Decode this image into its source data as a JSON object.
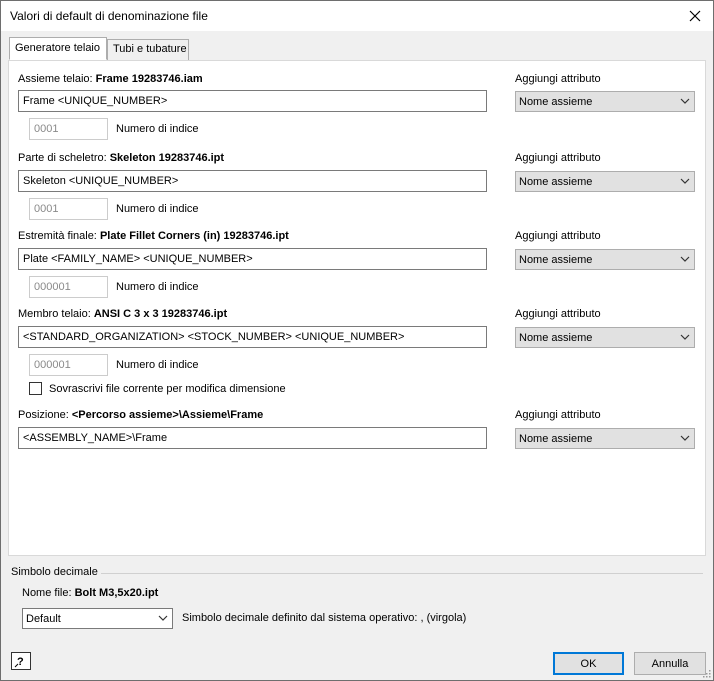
{
  "window": {
    "title": "Valori di default di denominazione file"
  },
  "tabs": [
    {
      "label": "Generatore telaio",
      "active": true
    },
    {
      "label": "Tubi e tubature",
      "active": false
    }
  ],
  "sections": [
    {
      "label": "Assieme telaio:",
      "value": "Frame 19283746.iam",
      "pattern": "Frame <UNIQUE_NUMBER>",
      "attr_label": "Aggiungi attributo",
      "attr_value": "Nome assieme",
      "index": "0001",
      "index_label": "Numero di indice"
    },
    {
      "label": "Parte di scheletro:",
      "value": "Skeleton 19283746.ipt",
      "pattern": "Skeleton <UNIQUE_NUMBER>",
      "attr_label": "Aggiungi attributo",
      "attr_value": "Nome assieme",
      "index": "0001",
      "index_label": "Numero di indice"
    },
    {
      "label": "Estremità finale:",
      "value": "Plate Fillet Corners (in) 19283746.ipt",
      "pattern": "Plate <FAMILY_NAME> <UNIQUE_NUMBER>",
      "attr_label": "Aggiungi attributo",
      "attr_value": "Nome assieme",
      "index": "000001",
      "index_label": "Numero di indice"
    },
    {
      "label": "Membro telaio:",
      "value": "ANSI C 3 x 3 19283746.ipt",
      "pattern": "<STANDARD_ORGANIZATION> <STOCK_NUMBER> <UNIQUE_NUMBER>",
      "attr_label": "Aggiungi attributo",
      "attr_value": "Nome assieme",
      "index": "000001",
      "index_label": "Numero di indice"
    }
  ],
  "overwrite_checkbox": {
    "label": "Sovrascrivi file corrente per modifica dimensione",
    "checked": false
  },
  "position": {
    "label": "Posizione:",
    "value": "<Percorso assieme>\\Assieme\\Frame",
    "pattern": "<ASSEMBLY_NAME>\\Frame",
    "attr_label": "Aggiungi attributo",
    "attr_value": "Nome assieme"
  },
  "decimal": {
    "group_label": "Simbolo decimale",
    "filename_label": "Nome file:",
    "filename_value": "Bolt M3,5x20.ipt",
    "combo_value": "Default",
    "os_text": "Simbolo decimale definito dal sistema operativo: , (virgola)"
  },
  "buttons": {
    "ok": "OK",
    "cancel": "Annulla"
  },
  "colors": {
    "accent": "#0078d7",
    "panel": "#ffffff",
    "background": "#f0f0f0"
  }
}
